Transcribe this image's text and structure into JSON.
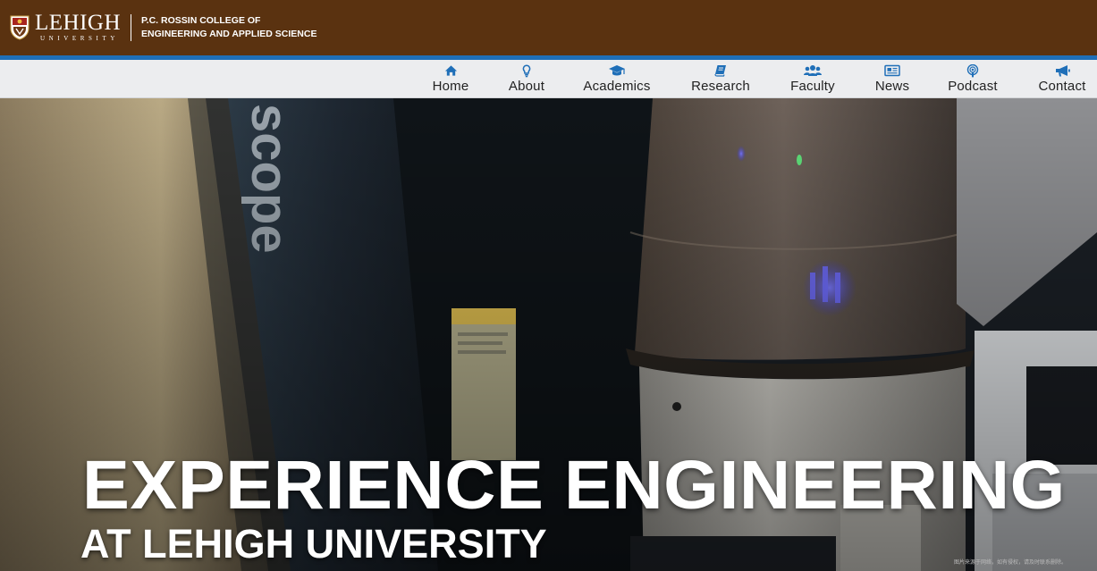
{
  "header": {
    "logo_text": "LEHIGH",
    "logo_subtext": "UNIVERSITY",
    "college_line1": "P.C. ROSSIN COLLEGE OF",
    "college_line2": "ENGINEERING AND APPLIED SCIENCE"
  },
  "nav": {
    "items": [
      {
        "label": "Home",
        "icon": "home-icon"
      },
      {
        "label": "About",
        "icon": "lightbulb-icon"
      },
      {
        "label": "Academics",
        "icon": "graduation-cap-icon"
      },
      {
        "label": "Research",
        "icon": "book-icon"
      },
      {
        "label": "Faculty",
        "icon": "users-icon"
      },
      {
        "label": "News",
        "icon": "newspaper-icon"
      },
      {
        "label": "Podcast",
        "icon": "podcast-icon"
      },
      {
        "label": "Contact",
        "icon": "bullhorn-icon"
      }
    ]
  },
  "hero": {
    "headline": "EXPERIENCE ENGINEERING",
    "subheadline": "AT LEHIGH UNIVERSITY",
    "photo_label": "scope",
    "credit": "图片来源于网络，如有侵权，请及时联系删除。"
  },
  "colors": {
    "brand_brown": "#5a3210",
    "accent_blue": "#1f6fb8",
    "nav_bg": "#ecedef",
    "nav_icon": "#1f6fb8"
  }
}
